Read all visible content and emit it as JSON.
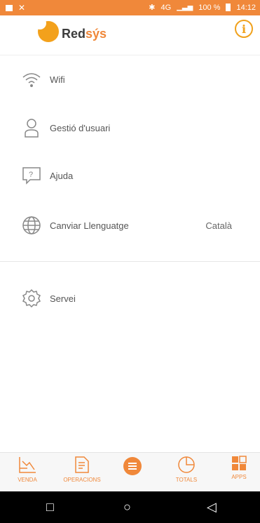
{
  "status_bar": {
    "left_icons": [
      "image-icon",
      "close-icon"
    ],
    "bluetooth": "✱",
    "network": "4G",
    "battery": "100 %",
    "time": "14:12"
  },
  "header": {
    "logo_text_main": "Red",
    "logo_text_accent": "sýs",
    "info_icon": "i"
  },
  "menu": {
    "items": [
      {
        "label": "Wifi",
        "icon": "wifi-icon"
      },
      {
        "label": "Gestió d'usuari",
        "icon": "user-icon"
      },
      {
        "label": "Ajuda",
        "icon": "help-icon"
      },
      {
        "label": "Canviar Llenguatge",
        "icon": "globe-icon",
        "value": "Català"
      },
      {
        "label": "Servei",
        "icon": "settings-icon"
      }
    ]
  },
  "bottom_nav": {
    "items": [
      {
        "label": "VENDA",
        "icon": "sale-icon"
      },
      {
        "label": "OPERACIONS",
        "icon": "operations-icon"
      },
      {
        "label": "",
        "icon": "menu-icon"
      },
      {
        "label": "TOTALS",
        "icon": "totals-icon"
      },
      {
        "label": "APPS",
        "icon": "apps-icon"
      }
    ]
  },
  "system_nav": {
    "recent": "□",
    "home": "○",
    "back": "◁"
  },
  "colors": {
    "accent": "#f0883a",
    "logo_yellow": "#f3a11c",
    "text": "#555555"
  }
}
